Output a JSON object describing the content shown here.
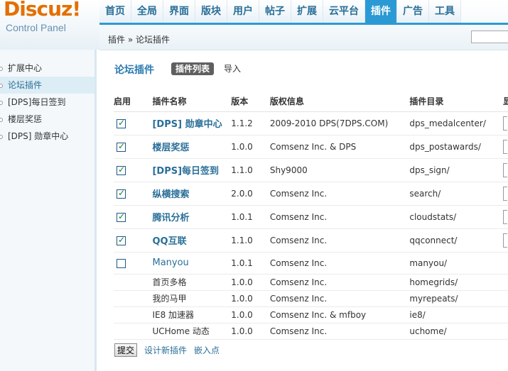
{
  "logo": {
    "main": "Discuz!",
    "sub": "Control Panel"
  },
  "nav": [
    "首页",
    "全局",
    "界面",
    "版块",
    "用户",
    "帖子",
    "扩展",
    "云平台",
    "插件",
    "广告",
    "工具"
  ],
  "nav_active": "插件",
  "breadcrumb": "插件 » 论坛插件",
  "sidebar": {
    "items": [
      {
        "label": "扩展中心"
      },
      {
        "label": "论坛插件"
      },
      {
        "label": "[DPS]每日签到"
      },
      {
        "label": "楼层奖惩"
      },
      {
        "label": "[DPS] 勋章中心"
      }
    ]
  },
  "main": {
    "title": "论坛插件",
    "tabs": [
      {
        "label": "插件列表"
      },
      {
        "label": "导入"
      }
    ]
  },
  "table": {
    "headers": [
      "启用",
      "插件名称",
      "版本",
      "版权信息",
      "插件目录",
      "显"
    ],
    "rows": [
      {
        "enabled": true,
        "name": "[DPS] 勋章中心",
        "version": "1.1.2",
        "copyright": "2009-2010 DPS(7DPS.COM)",
        "dir": "dps_medalcenter/"
      },
      {
        "enabled": true,
        "name": "楼层奖惩",
        "version": "1.0.0",
        "copyright": "Comsenz Inc. & DPS",
        "dir": "dps_postawards/"
      },
      {
        "enabled": true,
        "name": "[DPS]每日签到",
        "version": "1.1.0",
        "copyright": "Shy9000",
        "dir": "dps_sign/"
      },
      {
        "enabled": true,
        "name": "纵横搜索",
        "version": "2.0.0",
        "copyright": "Comsenz Inc.",
        "dir": "search/"
      },
      {
        "enabled": true,
        "name": "腾讯分析",
        "version": "1.0.1",
        "copyright": "Comsenz Inc.",
        "dir": "cloudstats/"
      },
      {
        "enabled": true,
        "name": "QQ互联",
        "version": "1.1.0",
        "copyright": "Comsenz Inc.",
        "dir": "qqconnect/"
      },
      {
        "enabled": false,
        "name": "Manyou",
        "version": "1.0.1",
        "copyright": "Comsenz Inc.",
        "dir": "manyou/"
      },
      {
        "name": "首页多格",
        "version": "1.0.0",
        "copyright": "Comsenz Inc.",
        "dir": "homegrids/"
      },
      {
        "name": "我的马甲",
        "version": "1.0.0",
        "copyright": "Comsenz Inc.",
        "dir": "myrepeats/"
      },
      {
        "name": "IE8 加速器",
        "version": "1.0.0",
        "copyright": "Comsenz Inc. & mfboy",
        "dir": "ie8/"
      },
      {
        "name": "UCHome 动态",
        "version": "1.0.0",
        "copyright": "Comsenz Inc.",
        "dir": "uchome/"
      }
    ]
  },
  "footer": {
    "submit": "提交",
    "design_link": "设计新插件",
    "hooks_link": "嵌入点"
  }
}
